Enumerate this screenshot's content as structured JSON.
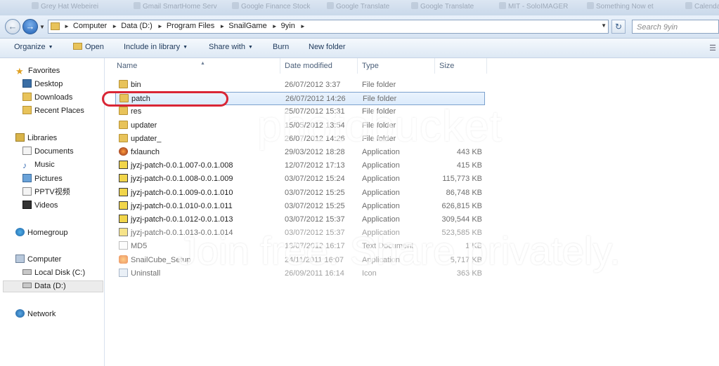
{
  "background_tabs": [
    {
      "label": "Grey Hat Webeirei"
    },
    {
      "label": "Gmail SmartHome Serv"
    },
    {
      "label": "Google Finance Stock"
    },
    {
      "label": "Google Translate"
    },
    {
      "label": "Google Translate"
    },
    {
      "label": "MIT - SoloIMAGER"
    },
    {
      "label": "Something Now et"
    },
    {
      "label": "Calendar"
    }
  ],
  "address": {
    "crumbs": [
      "Computer",
      "Data (D:)",
      "Program Files",
      "SnailGame",
      "9yin"
    ]
  },
  "search": {
    "placeholder": "Search 9yin"
  },
  "toolbar": {
    "organize": "Organize",
    "open": "Open",
    "include_in_library": "Include in library",
    "share_with": "Share with",
    "burn": "Burn",
    "new_folder": "New folder"
  },
  "nav": {
    "favorites": "Favorites",
    "desktop": "Desktop",
    "downloads": "Downloads",
    "recent_places": "Recent Places",
    "libraries": "Libraries",
    "documents": "Documents",
    "music": "Music",
    "pictures": "Pictures",
    "pptv": "PPTV视频",
    "videos": "Videos",
    "homegroup": "Homegroup",
    "computer": "Computer",
    "local_disk": "Local Disk (C:)",
    "data_disk": "Data (D:)",
    "network": "Network"
  },
  "columns": {
    "name": "Name",
    "date": "Date modified",
    "type": "Type",
    "size": "Size"
  },
  "files": [
    {
      "name": "bin",
      "date": "26/07/2012 3:37",
      "type": "File folder",
      "size": "",
      "icon": "folder-icon"
    },
    {
      "name": "patch",
      "date": "26/07/2012 14:26",
      "type": "File folder",
      "size": "",
      "icon": "folder-icon"
    },
    {
      "name": "res",
      "date": "25/07/2012 15:31",
      "type": "File folder",
      "size": "",
      "icon": "folder-icon"
    },
    {
      "name": "updater",
      "date": "15/05/2012 13:54",
      "type": "File folder",
      "size": "",
      "icon": "folder-icon"
    },
    {
      "name": "updater_",
      "date": "26/07/2012 14:26",
      "type": "File folder",
      "size": "",
      "icon": "folder-icon"
    },
    {
      "name": "fxlaunch",
      "date": "29/03/2012 18:28",
      "type": "Application",
      "size": "443 KB",
      "icon": "app-icon"
    },
    {
      "name": "jyzj-patch-0.0.1.007-0.0.1.008",
      "date": "12/07/2012 17:13",
      "type": "Application",
      "size": "415 KB",
      "icon": "patch-app-icon"
    },
    {
      "name": "jyzj-patch-0.0.1.008-0.0.1.009",
      "date": "03/07/2012 15:24",
      "type": "Application",
      "size": "115,773 KB",
      "icon": "patch-app-icon"
    },
    {
      "name": "jyzj-patch-0.0.1.009-0.0.1.010",
      "date": "03/07/2012 15:25",
      "type": "Application",
      "size": "86,748 KB",
      "icon": "patch-app-icon"
    },
    {
      "name": "jyzj-patch-0.0.1.010-0.0.1.011",
      "date": "03/07/2012 15:25",
      "type": "Application",
      "size": "626,815 KB",
      "icon": "patch-app-icon"
    },
    {
      "name": "jyzj-patch-0.0.1.012-0.0.1.013",
      "date": "03/07/2012 15:37",
      "type": "Application",
      "size": "309,544 KB",
      "icon": "patch-app-icon"
    },
    {
      "name": "jyzj-patch-0.0.1.013-0.0.1.014",
      "date": "03/07/2012 15:37",
      "type": "Application",
      "size": "523,585 KB",
      "icon": "patch-app-icon"
    },
    {
      "name": "MD5",
      "date": "13/07/2012 16:17",
      "type": "Text Document",
      "size": "1 KB",
      "icon": "text-document-icon"
    },
    {
      "name": "SnailCube_Setup",
      "date": "24/11/2011 16:07",
      "type": "Application",
      "size": "5,717 KB",
      "icon": "setup-app-icon"
    },
    {
      "name": "Uninstall",
      "date": "26/09/2011 16:14",
      "type": "Icon",
      "size": "363 KB",
      "icon": "icon-file-icon"
    }
  ],
  "selected_file": "patch",
  "watermark": {
    "line1": "photobucket",
    "line2": "Join free. Share privately."
  },
  "colors": {
    "highlight_circle": "#d92635",
    "selection": "#dcebfc",
    "nav_bg": "#dde8f4"
  }
}
